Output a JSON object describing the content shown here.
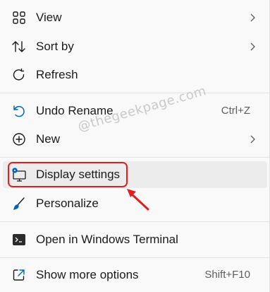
{
  "menu": {
    "items": [
      {
        "label": "View",
        "icon": "grid-icon",
        "submenu": true
      },
      {
        "label": "Sort by",
        "icon": "sort-arrows-icon",
        "submenu": true
      },
      {
        "label": "Refresh",
        "icon": "refresh-icon"
      },
      {
        "label": "Undo Rename",
        "icon": "undo-icon",
        "shortcut": "Ctrl+Z"
      },
      {
        "label": "New",
        "icon": "plus-circle-icon",
        "submenu": true
      },
      {
        "label": "Display settings",
        "icon": "display-settings-icon",
        "highlighted": true
      },
      {
        "label": "Personalize",
        "icon": "brush-icon"
      },
      {
        "label": "Open in Windows Terminal",
        "icon": "terminal-icon"
      },
      {
        "label": "Show more options",
        "icon": "share-icon",
        "shortcut": "Shift+F10"
      }
    ]
  },
  "watermark": "@thegeekpage.com",
  "colors": {
    "accent": "#0067c0",
    "highlight_border": "#e02020",
    "background": "#f9f9f9"
  }
}
